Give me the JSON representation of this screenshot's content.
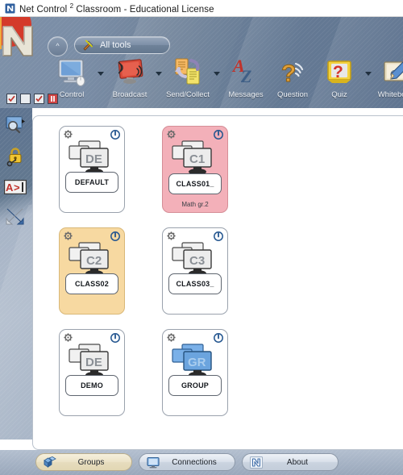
{
  "window": {
    "title_prefix": "Net Control ",
    "title_sup": "2",
    "title_suffix": " Classroom - Educational License",
    "icon": "app-n-icon"
  },
  "ribbon": {
    "collapse_label": "^",
    "all_tools_label": "All tools",
    "all_tools_icon": "tools-hammer-icon",
    "buttons": [
      {
        "label": "Control",
        "icon": "monitor-control-icon",
        "has_dropdown": true
      },
      {
        "label": "Broadcast",
        "icon": "broadcast-screen-icon",
        "has_dropdown": true
      },
      {
        "label": "Send/Collect",
        "icon": "send-collect-icon",
        "has_dropdown": true
      },
      {
        "label": "Messages",
        "icon": "az-messages-icon",
        "has_dropdown": false
      },
      {
        "label": "Question",
        "icon": "question-mark-icon",
        "has_dropdown": false
      },
      {
        "label": "Quiz",
        "icon": "quiz-icon",
        "has_dropdown": true
      },
      {
        "label": "Whiteboard",
        "icon": "whiteboard-pencil-icon",
        "has_dropdown": false
      }
    ]
  },
  "checkbar": {
    "items": [
      {
        "icon": "checkbox-checked-icon",
        "state": "checked"
      },
      {
        "icon": "checkbox-empty-icon",
        "state": "unchecked"
      },
      {
        "icon": "checkbox-checked-icon",
        "state": "checked"
      },
      {
        "icon": "checkbox-red-icon",
        "state": "alert"
      }
    ]
  },
  "rail": {
    "items": [
      {
        "icon": "monitor-magnifier-icon",
        "label": "view"
      },
      {
        "icon": "lock-icon",
        "label": "lock"
      },
      {
        "icon": "a-prompt-icon",
        "label": "command"
      },
      {
        "icon": "arrows-cross-icon",
        "label": "connections"
      }
    ]
  },
  "groups": {
    "cards": [
      {
        "name": "DEFAULT",
        "badge": "DE",
        "subtitle": "",
        "state": "normal",
        "monitor_color": "gray",
        "gear_icon": "gear-icon",
        "power_icon": "power-icon"
      },
      {
        "name": "CLASS01_",
        "badge": "C1",
        "subtitle": "Math gr.2",
        "state": "selected-pink",
        "monitor_color": "gray",
        "gear_icon": "gear-icon",
        "power_icon": "power-icon"
      },
      {
        "name": "CLASS02",
        "badge": "C2",
        "subtitle": "",
        "state": "selected-amber",
        "monitor_color": "gray",
        "gear_icon": "gear-icon",
        "power_icon": "power-icon"
      },
      {
        "name": "CLASS03_",
        "badge": "C3",
        "subtitle": "",
        "state": "normal",
        "monitor_color": "gray",
        "gear_icon": "gear-icon",
        "power_icon": "power-icon"
      },
      {
        "name": "DEMO",
        "badge": "DE",
        "subtitle": "",
        "state": "normal",
        "monitor_color": "gray",
        "gear_icon": "gear-icon",
        "power_icon": "power-icon"
      },
      {
        "name": "GROUP",
        "badge": "GR",
        "subtitle": "",
        "state": "normal",
        "monitor_color": "blue",
        "gear_icon": "gear-icon",
        "power_icon": "power-icon"
      }
    ]
  },
  "bottom_tabs": [
    {
      "label": "Groups",
      "icon": "groups-cubes-icon",
      "active": true
    },
    {
      "label": "Connections",
      "icon": "monitor-icon",
      "active": false
    },
    {
      "label": "About",
      "icon": "app-n-icon",
      "active": false
    }
  ],
  "colors": {
    "banner": "#6f8299",
    "selected_pink": "#f3b0b9",
    "selected_amber": "#f7d9a1",
    "panel": "#ffffff",
    "active_tab": "#ece3c8"
  }
}
